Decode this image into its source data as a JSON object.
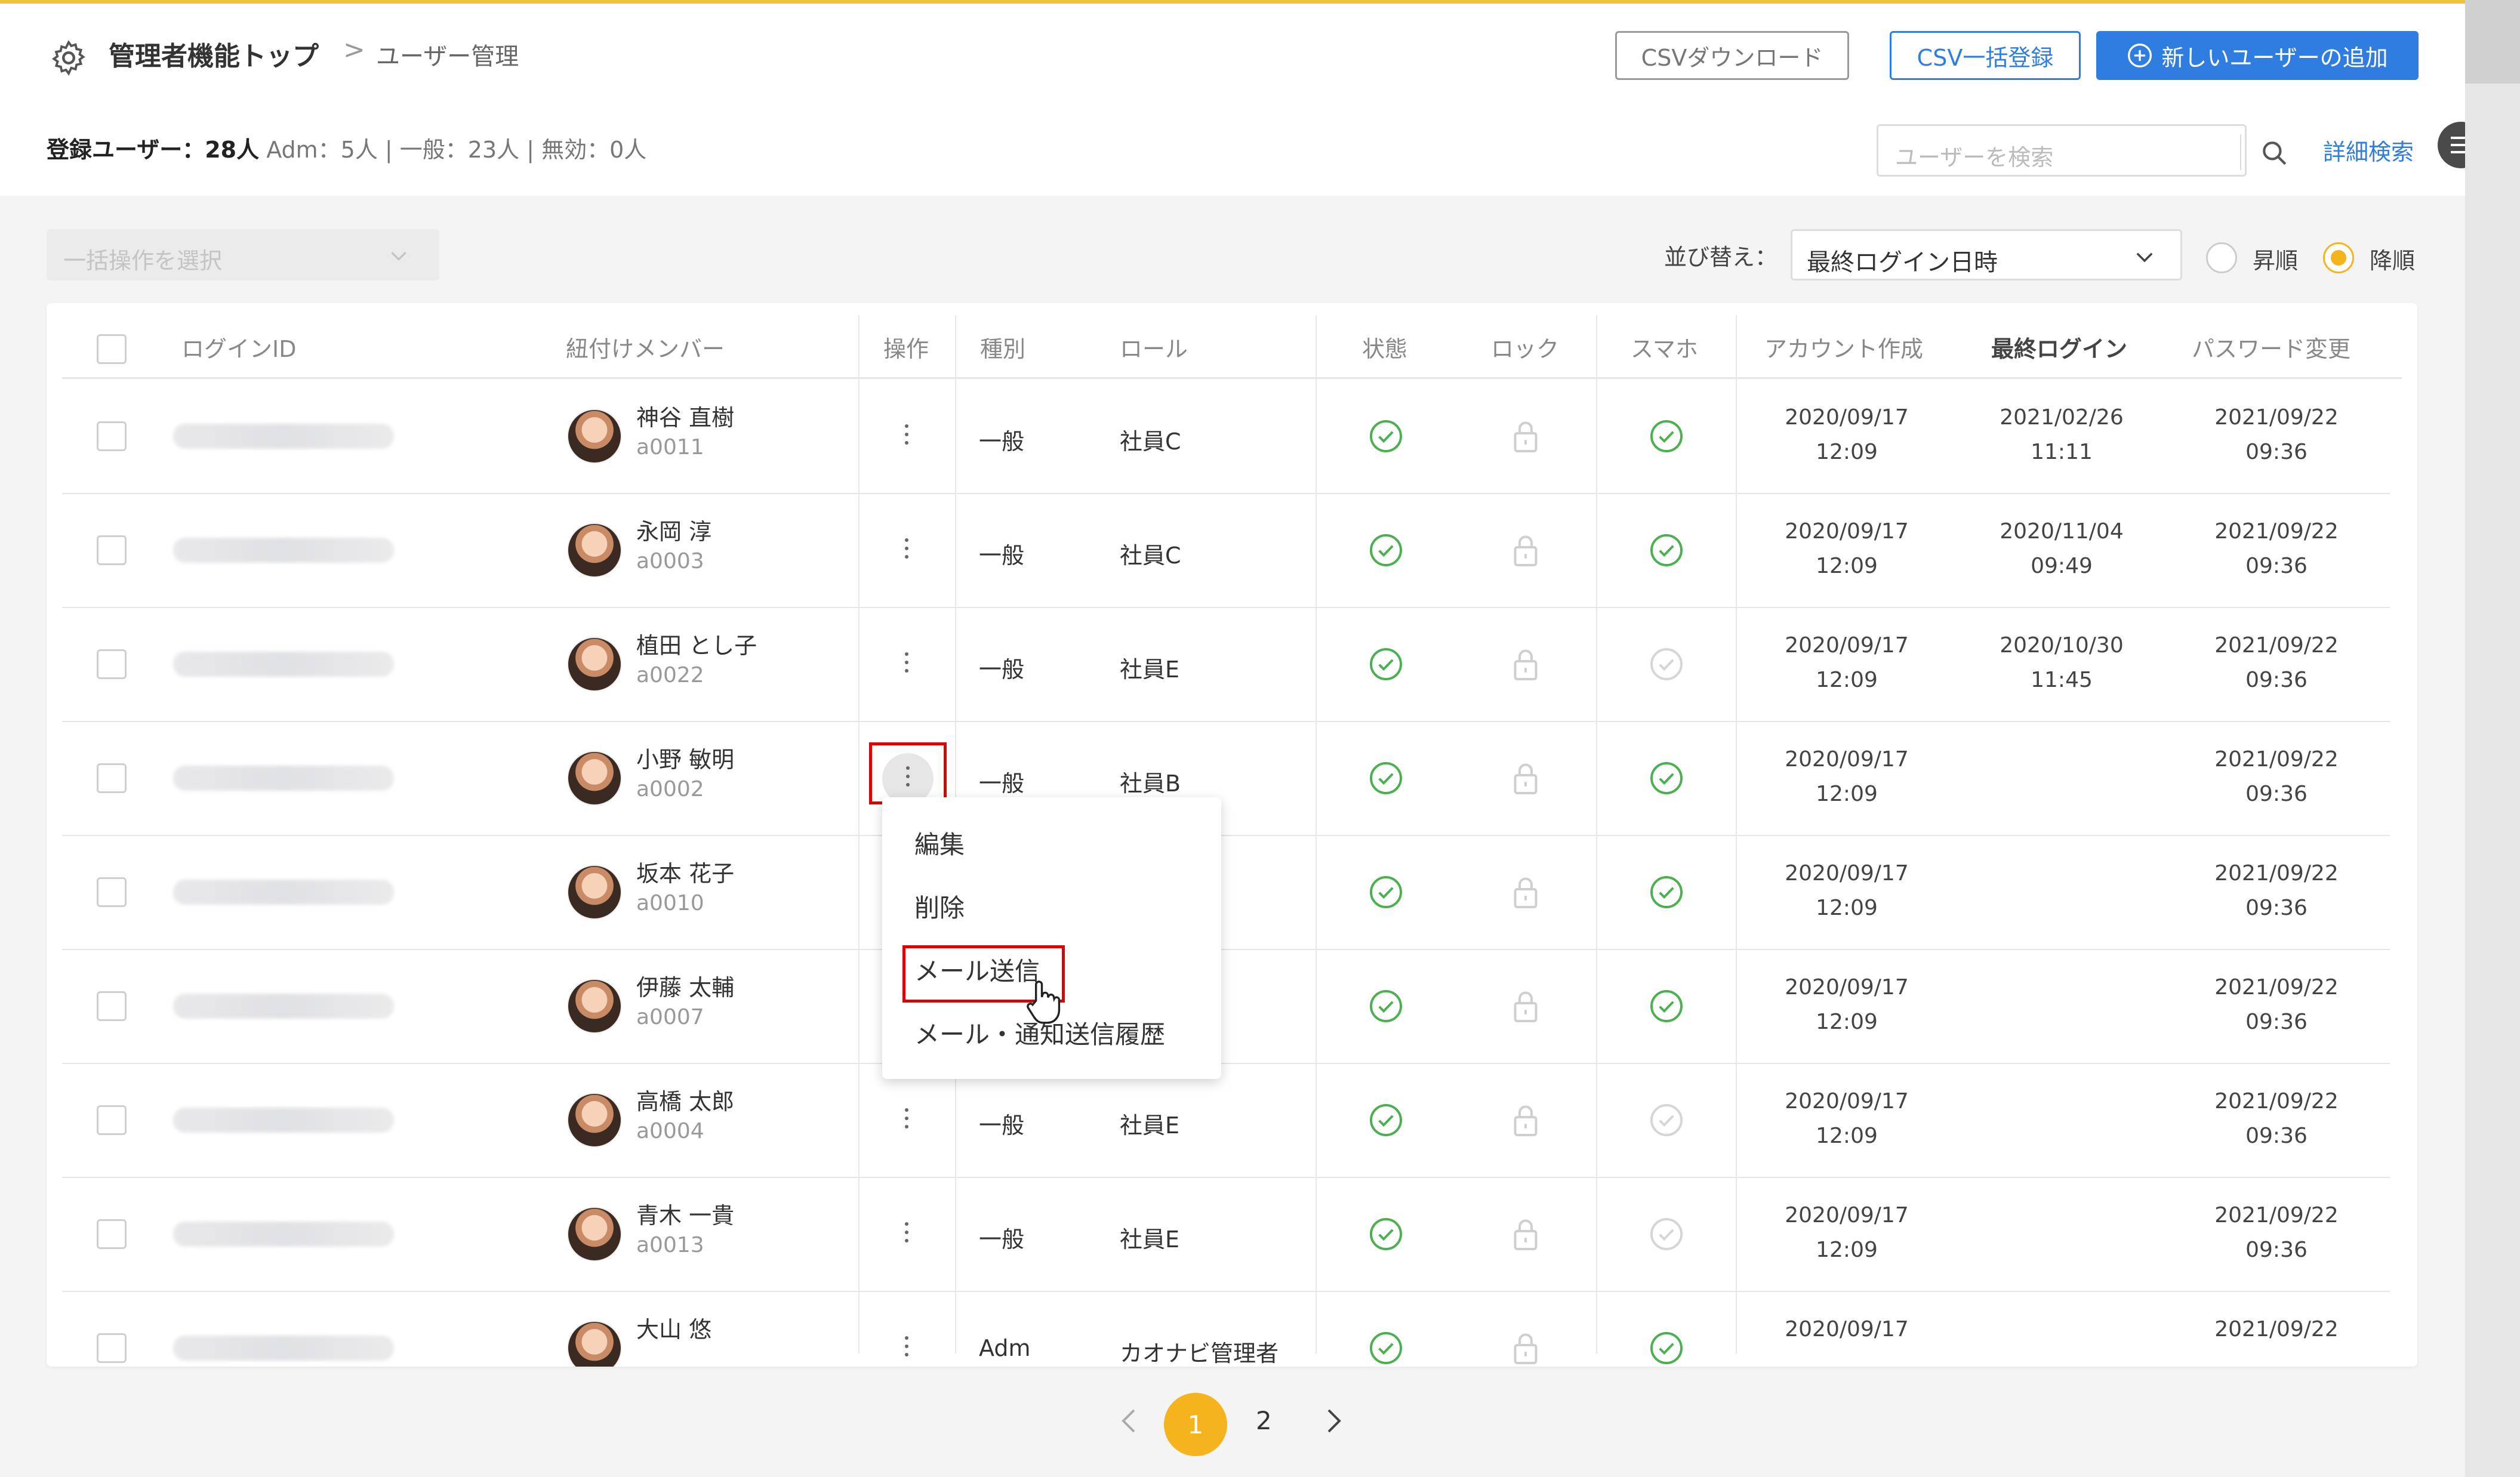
{
  "header": {
    "breadcrumb_top": "管理者機能トップ",
    "breadcrumb_sep": ">",
    "breadcrumb_current": "ユーザー管理",
    "csv_download": "CSVダウンロード",
    "csv_bulk_register": "CSV一括登録",
    "add_user": "新しいユーザーの追加"
  },
  "summary": {
    "registered_label": "登録ユーザー：28人",
    "rest": " Adm：5人 | 一般：23人 | 無効：0人",
    "search_placeholder": "ユーザーを検索",
    "advanced_search": "詳細検索"
  },
  "filters": {
    "bulk_placeholder": "一括操作を選択",
    "sort_label": "並び替え：",
    "sort_value": "最終ログイン日時",
    "asc": "昇順",
    "desc": "降順",
    "selected_order": "desc"
  },
  "columns": {
    "login_id": "ログインID",
    "member": "紐付けメンバー",
    "ops": "操作",
    "type": "種別",
    "role": "ロール",
    "status": "状態",
    "lock": "ロック",
    "phone": "スマホ",
    "created": "アカウント作成",
    "last_login": "最終ログイン",
    "pw_changed": "パスワード変更"
  },
  "rows": [
    {
      "name": "神谷 直樹",
      "code": "a0011",
      "type": "一般",
      "role": "社員C",
      "phone_ok": true,
      "created_d": "2020/09/17",
      "created_t": "12:09",
      "login_d": "2021/02/26",
      "login_t": "11:11",
      "pw_d": "2021/09/22",
      "pw_t": "09:36"
    },
    {
      "name": "永岡 淳",
      "code": "a0003",
      "type": "一般",
      "role": "社員C",
      "phone_ok": true,
      "created_d": "2020/09/17",
      "created_t": "12:09",
      "login_d": "2020/11/04",
      "login_t": "09:49",
      "pw_d": "2021/09/22",
      "pw_t": "09:36"
    },
    {
      "name": "植田 とし子",
      "code": "a0022",
      "type": "一般",
      "role": "社員E",
      "phone_ok": false,
      "created_d": "2020/09/17",
      "created_t": "12:09",
      "login_d": "2020/10/30",
      "login_t": "11:45",
      "pw_d": "2021/09/22",
      "pw_t": "09:36"
    },
    {
      "name": "小野 敏明",
      "code": "a0002",
      "type": "一般",
      "role": "社員B",
      "phone_ok": true,
      "created_d": "2020/09/17",
      "created_t": "12:09",
      "login_d": "",
      "login_t": "",
      "pw_d": "2021/09/22",
      "pw_t": "09:36"
    },
    {
      "name": "坂本 花子",
      "code": "a0010",
      "type": "",
      "role": "",
      "phone_ok": true,
      "created_d": "2020/09/17",
      "created_t": "12:09",
      "login_d": "",
      "login_t": "",
      "pw_d": "2021/09/22",
      "pw_t": "09:36"
    },
    {
      "name": "伊藤 太輔",
      "code": "a0007",
      "type": "",
      "role": "",
      "phone_ok": true,
      "created_d": "2020/09/17",
      "created_t": "12:09",
      "login_d": "",
      "login_t": "",
      "pw_d": "2021/09/22",
      "pw_t": "09:36"
    },
    {
      "name": "高橋 太郎",
      "code": "a0004",
      "type": "一般",
      "role": "社員E",
      "phone_ok": false,
      "created_d": "2020/09/17",
      "created_t": "12:09",
      "login_d": "",
      "login_t": "",
      "pw_d": "2021/09/22",
      "pw_t": "09:36"
    },
    {
      "name": "青木 一貴",
      "code": "a0013",
      "type": "一般",
      "role": "社員E",
      "phone_ok": false,
      "created_d": "2020/09/17",
      "created_t": "12:09",
      "login_d": "",
      "login_t": "",
      "pw_d": "2021/09/22",
      "pw_t": "09:36"
    },
    {
      "name": "大山 悠",
      "code": "",
      "type": "Adm",
      "role": "カオナビ管理者",
      "phone_ok": true,
      "created_d": "2020/09/17",
      "created_t": "",
      "login_d": "",
      "login_t": "",
      "pw_d": "2021/09/22",
      "pw_t": ""
    }
  ],
  "context_menu": {
    "edit": "編集",
    "delete": "削除",
    "send_mail": "メール送信",
    "history": "メール・通知送信履歴"
  },
  "pagination": {
    "page1": "1",
    "page2": "2"
  },
  "colors": {
    "accent": "#2f7de1",
    "active": "#f5b31d",
    "check": "#4caf50",
    "highlight": "#e00000"
  }
}
